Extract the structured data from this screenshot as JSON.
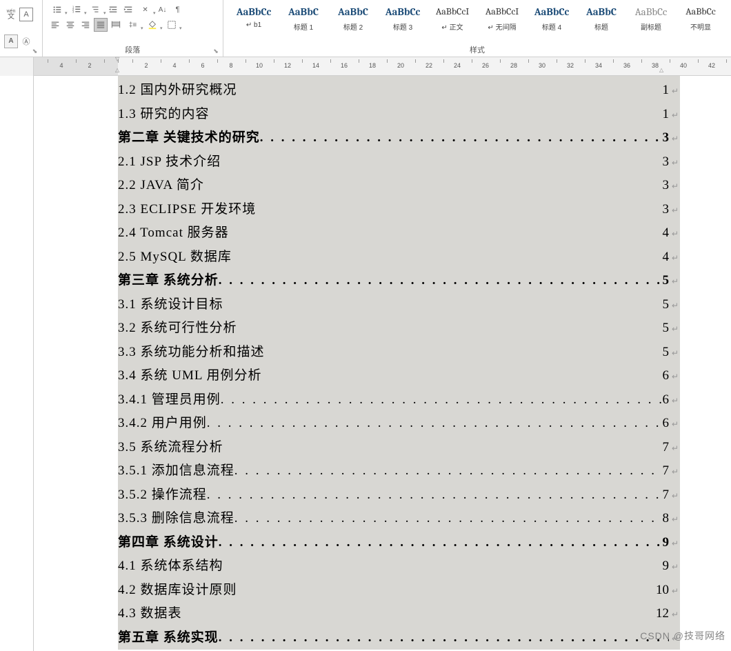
{
  "toolbar": {
    "paragraph_label": "段落",
    "styles_label": "样式"
  },
  "styles": [
    {
      "sample": "AaBbCc",
      "name": "↵ b1",
      "cls": "heading"
    },
    {
      "sample": "AaBbC",
      "name": "标题 1",
      "cls": "heading"
    },
    {
      "sample": "AaBbC",
      "name": "标题 2",
      "cls": "heading"
    },
    {
      "sample": "AaBbCc",
      "name": "标题 3",
      "cls": "heading"
    },
    {
      "sample": "AaBbCcI",
      "name": "↵ 正文",
      "cls": "body"
    },
    {
      "sample": "AaBbCcI",
      "name": "↵ 无间隔",
      "cls": "body"
    },
    {
      "sample": "AaBbCc",
      "name": "标题 4",
      "cls": "heading"
    },
    {
      "sample": "AaBbC",
      "name": "标题",
      "cls": "heading"
    },
    {
      "sample": "AaBbCc",
      "name": "副标题",
      "cls": "subtitle"
    },
    {
      "sample": "AaBbCc",
      "name": "不明显",
      "cls": "body"
    }
  ],
  "ruler": {
    "ticks": [
      -4,
      -2,
      2,
      4,
      6,
      8,
      10,
      12,
      14,
      16,
      18,
      20,
      22,
      24,
      26,
      28,
      30,
      32,
      34,
      36,
      38,
      40,
      42
    ]
  },
  "toc": [
    {
      "text": "1.2 国内外研究概况",
      "page": "1",
      "dots": false,
      "bold": false
    },
    {
      "text": "1.3 研究的内容",
      "page": "1",
      "dots": false,
      "bold": false
    },
    {
      "text": "第二章 关键技术的研究",
      "page": "3",
      "dots": true,
      "bold": true
    },
    {
      "text": "2.1 JSP 技术介绍",
      "page": "3",
      "dots": false,
      "bold": false
    },
    {
      "text": "2.2 JAVA 简介",
      "page": "3",
      "dots": false,
      "bold": false
    },
    {
      "text": "2.3 ECLIPSE 开发环境",
      "page": "3",
      "dots": false,
      "bold": false
    },
    {
      "text": "2.4 Tomcat 服务器",
      "page": "4",
      "dots": false,
      "bold": false
    },
    {
      "text": "2.5 MySQL 数据库",
      "page": "4",
      "dots": false,
      "bold": false
    },
    {
      "text": "第三章 系统分析",
      "page": "5",
      "dots": true,
      "bold": true
    },
    {
      "text": "3.1 系统设计目标",
      "page": "5",
      "dots": false,
      "bold": false
    },
    {
      "text": "3.2 系统可行性分析",
      "page": "5",
      "dots": false,
      "bold": false
    },
    {
      "text": "3.3 系统功能分析和描述",
      "page": "5",
      "dots": false,
      "bold": false
    },
    {
      "text": "3.4 系统 UML 用例分析",
      "page": "6",
      "dots": false,
      "bold": false
    },
    {
      "text": "3.4.1 管理员用例",
      "page": "6",
      "dots": true,
      "bold": false
    },
    {
      "text": "3.4.2 用户用例",
      "page": "6",
      "dots": true,
      "bold": false
    },
    {
      "text": "3.5 系统流程分析",
      "page": "7",
      "dots": false,
      "bold": false
    },
    {
      "text": "3.5.1 添加信息流程",
      "page": "7",
      "dots": true,
      "bold": false
    },
    {
      "text": "3.5.2 操作流程",
      "page": "7",
      "dots": true,
      "bold": false
    },
    {
      "text": "3.5.3 删除信息流程",
      "page": "8",
      "dots": true,
      "bold": false
    },
    {
      "text": "第四章 系统设计",
      "page": "9",
      "dots": true,
      "bold": true
    },
    {
      "text": "4.1 系统体系结构",
      "page": "9",
      "dots": false,
      "bold": false
    },
    {
      "text": "4.2 数据库设计原则",
      "page": "10",
      "dots": false,
      "bold": false
    },
    {
      "text": "4.3 数据表",
      "page": "12",
      "dots": false,
      "bold": false
    },
    {
      "text": "第五章 系统实现",
      "page": "",
      "dots": true,
      "bold": true
    }
  ],
  "watermark": "CSDN @技哥网络"
}
